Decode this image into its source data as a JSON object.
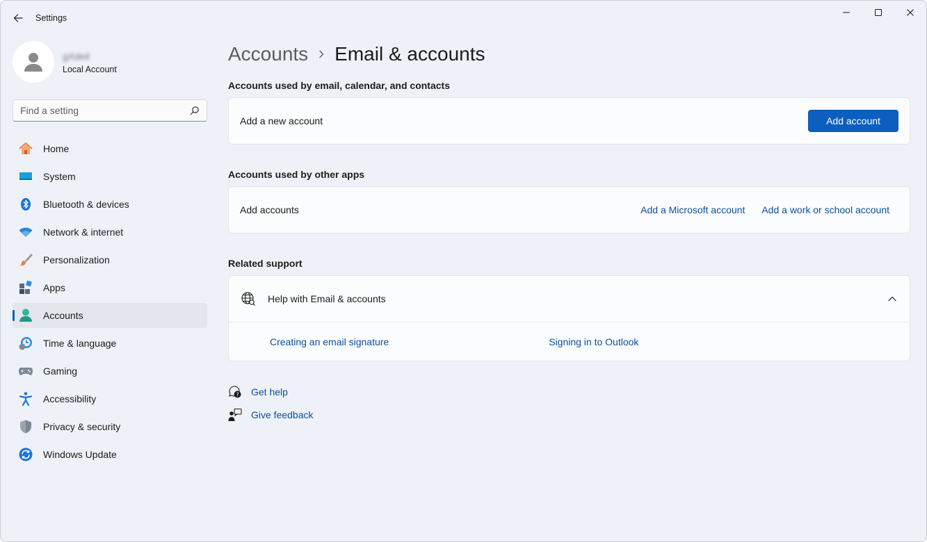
{
  "window": {
    "title": "Settings"
  },
  "profile": {
    "name": "gXdeil",
    "account_type": "Local Account"
  },
  "search": {
    "placeholder": "Find a setting"
  },
  "nav": {
    "items": [
      {
        "label": "Home",
        "icon": "home-icon"
      },
      {
        "label": "System",
        "icon": "system-icon"
      },
      {
        "label": "Bluetooth & devices",
        "icon": "bluetooth-icon"
      },
      {
        "label": "Network & internet",
        "icon": "wifi-icon"
      },
      {
        "label": "Personalization",
        "icon": "brush-icon"
      },
      {
        "label": "Apps",
        "icon": "apps-icon"
      },
      {
        "label": "Accounts",
        "icon": "person-icon",
        "active": true
      },
      {
        "label": "Time & language",
        "icon": "clock-globe-icon"
      },
      {
        "label": "Gaming",
        "icon": "gamepad-icon"
      },
      {
        "label": "Accessibility",
        "icon": "accessibility-icon"
      },
      {
        "label": "Privacy & security",
        "icon": "shield-icon"
      },
      {
        "label": "Windows Update",
        "icon": "update-icon"
      }
    ]
  },
  "breadcrumb": {
    "parent": "Accounts",
    "current": "Email & accounts"
  },
  "email_section": {
    "title": "Accounts used by email, calendar, and contacts",
    "row_label": "Add a new account",
    "button_label": "Add account"
  },
  "apps_section": {
    "title": "Accounts used by other apps",
    "row_label": "Add accounts",
    "link_microsoft": "Add a Microsoft account",
    "link_work": "Add a work or school account"
  },
  "support_section": {
    "title": "Related support",
    "help_label": "Help with Email & accounts",
    "links": [
      "Creating an email signature",
      "Signing in to Outlook"
    ]
  },
  "footer": {
    "get_help": "Get help",
    "give_feedback": "Give feedback"
  },
  "colors": {
    "accent": "#0c5fbe",
    "link": "#0a4f9a",
    "window_bg": "#eef2f8"
  }
}
